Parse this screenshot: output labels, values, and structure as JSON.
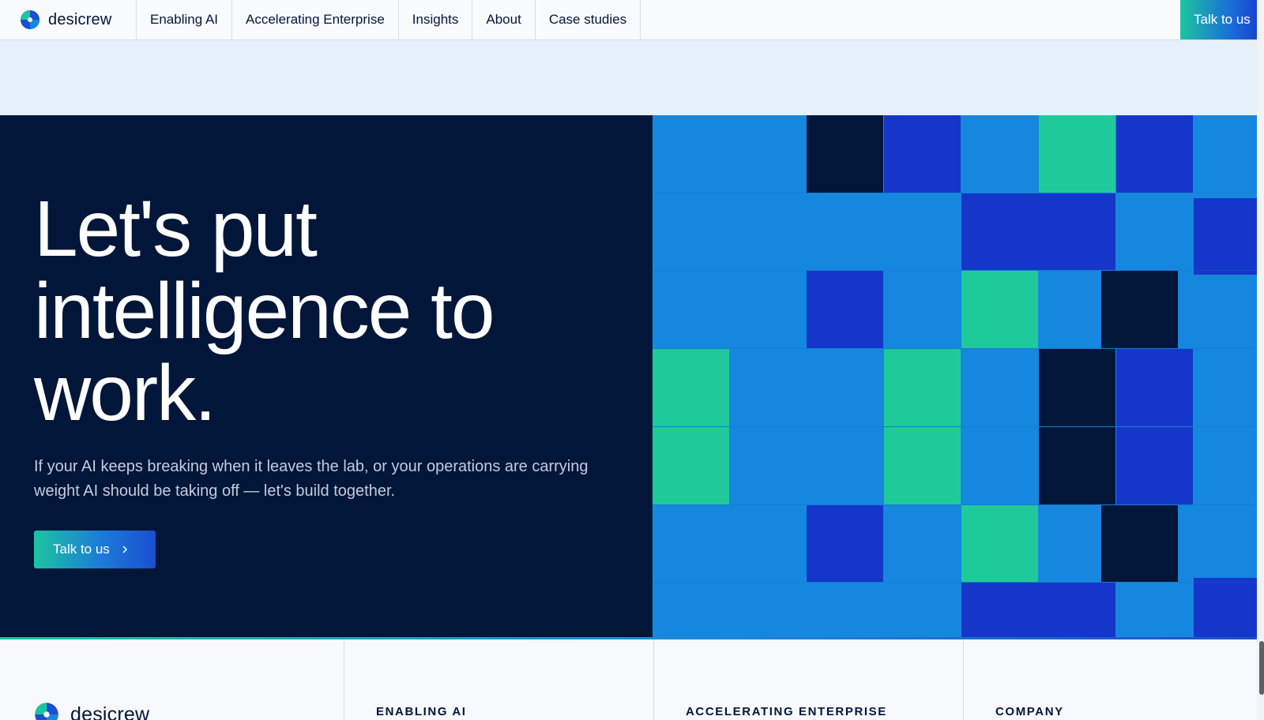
{
  "brand": {
    "name": "desicrew"
  },
  "nav": {
    "items": [
      "Enabling AI",
      "Accelerating Enterprise",
      "Insights",
      "About",
      "Case studies"
    ],
    "cta_label": "Talk to us"
  },
  "hero": {
    "title_lines": [
      "Let's put",
      "intelligence to",
      "work."
    ],
    "subtitle": "If your AI keeps breaking when it leaves the lab, or your operations are carrying weight AI should be taking off — let's build together.",
    "cta_label": "Talk to us"
  },
  "footer": {
    "columns": [
      "ENABLING AI",
      "ACCELERATING ENTERPRISE",
      "COMPANY"
    ]
  },
  "colors": {
    "navy": "#02163a",
    "blue": "#1687df",
    "royal": "#1537c9",
    "teal": "#1fca9a",
    "band": "#e6f1fb"
  }
}
